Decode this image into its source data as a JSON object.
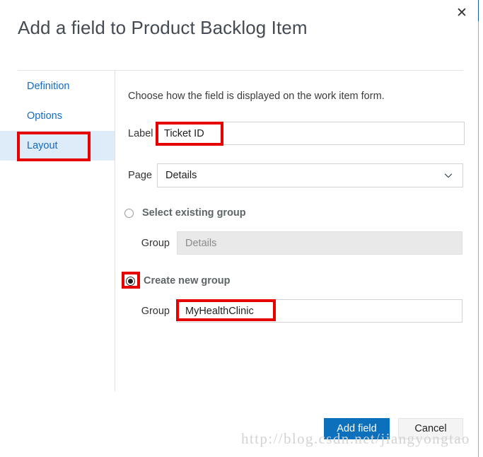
{
  "dialog": {
    "title": "Add a field to Product Backlog Item",
    "close_icon": "close-icon"
  },
  "sidebar": {
    "tabs": [
      {
        "label": "Definition",
        "selected": false
      },
      {
        "label": "Options",
        "selected": false
      },
      {
        "label": "Layout",
        "selected": true
      }
    ]
  },
  "main": {
    "intro": "Choose how the field is displayed on the work item form.",
    "label_field": {
      "label": "Label",
      "value": "Ticket ID",
      "placeholder": ""
    },
    "page_field": {
      "label": "Page",
      "value": "Details",
      "chevron_icon": "chevron-down-icon"
    },
    "existing_group": {
      "radio_label": "Select existing group",
      "checked": false,
      "group_label": "Group",
      "group_value": "",
      "group_placeholder": "Details",
      "disabled": true
    },
    "new_group": {
      "radio_label": "Create new group",
      "checked": true,
      "group_label": "Group",
      "group_value": "MyHealthClinic",
      "group_placeholder": ""
    }
  },
  "footer": {
    "primary_label": "Add field",
    "secondary_label": "Cancel"
  },
  "watermark": {
    "text": "http://blog.csdn.net/jiangyongtao"
  },
  "colors": {
    "accent": "#0c70bd",
    "tab_link": "#136bc0",
    "tab_selected_bg": "#deecf9",
    "annotation": "#e60000",
    "disabled_bg": "#e9e9e9"
  }
}
